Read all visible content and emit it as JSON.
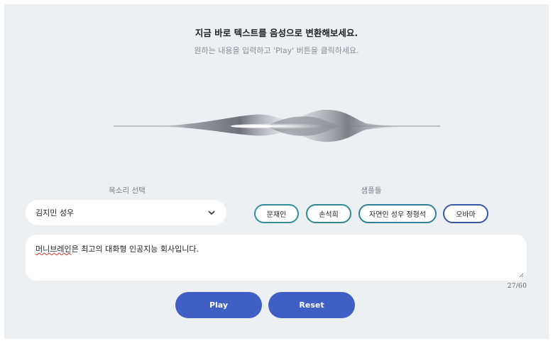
{
  "header": {
    "title": "지금 바로 텍스트를 음성으로 변환해보세요.",
    "subtitle": "원하는 내용을 입력하고 'Play' 버튼을 클릭하세요."
  },
  "voice": {
    "label": "목소리 선택",
    "selected": "김지민 성우"
  },
  "samples": {
    "label": "샘플들",
    "items": [
      "문재인",
      "손석희",
      "자연인 성우 정형석",
      "오바마"
    ]
  },
  "input": {
    "prefix": "머니브레인",
    "rest": "은 최고의 대화형 인공지능 회사입니다.",
    "counter": "27/60"
  },
  "buttons": {
    "play": "Play",
    "reset": "Reset"
  },
  "colors": {
    "accent": "#3f5fc4",
    "sample_border": "#2f8fa0",
    "background": "#edf0f3"
  },
  "icons": {
    "dropdown": "chevron-down-icon",
    "visualizer": "sound-wave"
  }
}
